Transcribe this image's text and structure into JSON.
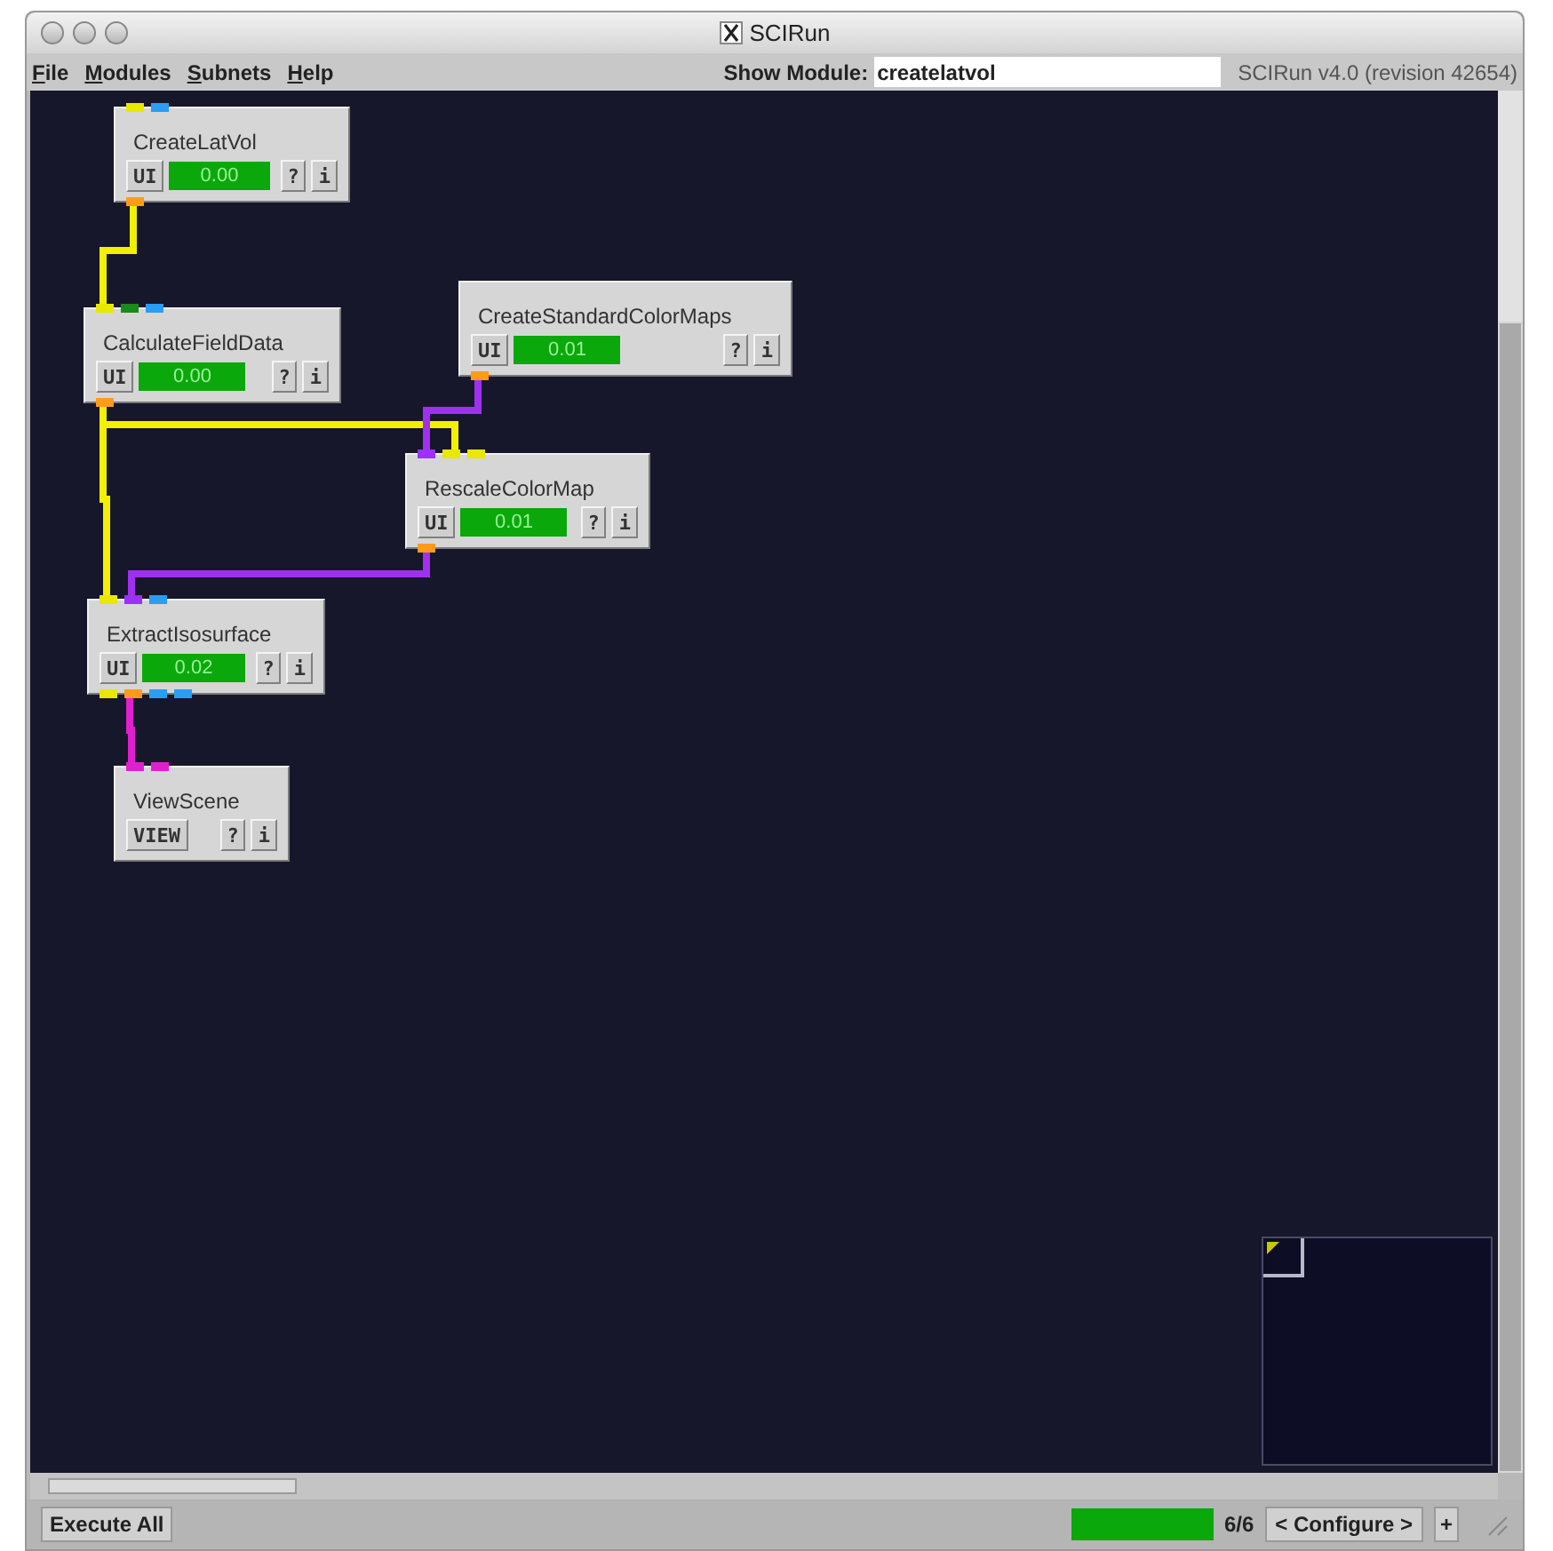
{
  "window": {
    "title": "SCIRun"
  },
  "menu": [
    {
      "label": "File"
    },
    {
      "label": "Modules"
    },
    {
      "label": "Subnets"
    },
    {
      "label": "Help"
    }
  ],
  "show_module": {
    "label": "Show Module:",
    "value": "createlatvol"
  },
  "version": "SCIRun v4.0 (revision 42654)",
  "modules": [
    {
      "name": "CreateLatVol",
      "ui": "UI",
      "time": "0.00",
      "help": "?",
      "info": "i",
      "inputs": [
        {
          "color": "#e8e800"
        },
        {
          "color": "#2a9df4"
        }
      ],
      "outputs": [
        {
          "color": "#ff9a1a"
        }
      ]
    },
    {
      "name": "CalculateFieldData",
      "ui": "UI",
      "time": "0.00",
      "help": "?",
      "info": "i",
      "inputs": [
        {
          "color": "#e8e800"
        },
        {
          "color": "#1a8a1a"
        },
        {
          "color": "#2a9df4"
        }
      ],
      "outputs": [
        {
          "color": "#ff9a1a"
        }
      ]
    },
    {
      "name": "CreateStandardColorMaps",
      "ui": "UI",
      "time": "0.01",
      "help": "?",
      "info": "i",
      "outputs": [
        {
          "color": "#ff9a1a"
        }
      ]
    },
    {
      "name": "RescaleColorMap",
      "ui": "UI",
      "time": "0.01",
      "help": "?",
      "info": "i",
      "inputs": [
        {
          "color": "#9b30ff"
        },
        {
          "color": "#e8e800"
        },
        {
          "color": "#e8e800"
        }
      ],
      "outputs": [
        {
          "color": "#ff9a1a"
        }
      ]
    },
    {
      "name": "ExtractIsosurface",
      "ui": "UI",
      "time": "0.02",
      "help": "?",
      "info": "i",
      "inputs": [
        {
          "color": "#e8e800"
        },
        {
          "color": "#9b30ff"
        },
        {
          "color": "#2a9df4"
        }
      ],
      "outputs": [
        {
          "color": "#e8e800"
        },
        {
          "color": "#ff9a1a"
        },
        {
          "color": "#2a9df4"
        },
        {
          "color": "#2a9df4"
        }
      ]
    },
    {
      "name": "ViewScene",
      "ui": "VIEW",
      "help": "?",
      "info": "i",
      "inputs": [
        {
          "color": "#e020d0"
        },
        {
          "color": "#e020d0"
        }
      ]
    }
  ],
  "wires": [
    {
      "color": "#f0f000"
    },
    {
      "color": "#f0f000"
    },
    {
      "color": "#f0f000"
    },
    {
      "color": "#a030f0"
    },
    {
      "color": "#a030f0"
    },
    {
      "color": "#e020d0"
    }
  ],
  "bottom_bar": {
    "execute": "Execute All",
    "progress": {
      "level": 1
    },
    "count": "6/6",
    "configure": "< Configure >",
    "add": "+"
  }
}
